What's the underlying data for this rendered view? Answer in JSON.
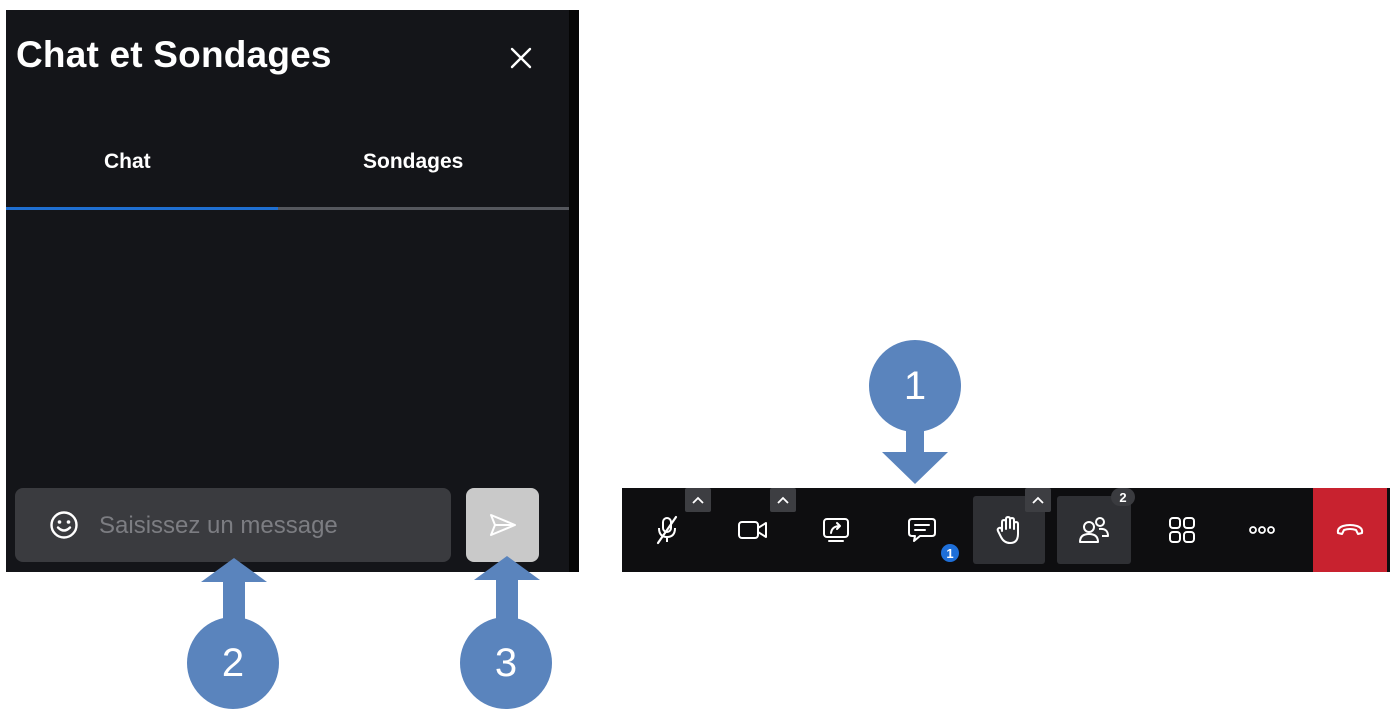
{
  "chat_panel": {
    "title": "Chat et Sondages",
    "close_icon": "close-icon",
    "tabs": [
      {
        "label": "Chat",
        "active": true
      },
      {
        "label": "Sondages",
        "active": false
      }
    ],
    "input": {
      "placeholder": "Saisissez un message",
      "value": "",
      "emoji_icon": "emoji-icon"
    },
    "send_icon": "send-icon"
  },
  "toolbar": {
    "items": [
      {
        "name": "microphone-muted",
        "icon": "mic-off-icon",
        "has_menu": true
      },
      {
        "name": "camera",
        "icon": "video-camera-icon",
        "has_menu": true
      },
      {
        "name": "share-screen",
        "icon": "screen-share-icon"
      },
      {
        "name": "chat",
        "icon": "chat-bubble-icon",
        "badge": "1"
      },
      {
        "name": "raise-hand",
        "icon": "hand-icon",
        "has_menu": true
      },
      {
        "name": "participants",
        "icon": "participants-icon",
        "badge": "2"
      },
      {
        "name": "view",
        "icon": "grid-icon"
      },
      {
        "name": "more",
        "icon": "more-dots-icon"
      },
      {
        "name": "end-call",
        "icon": "phone-hangup-icon"
      }
    ],
    "colors": {
      "background": "#0e0e10",
      "end_call": "#c8222f",
      "badge": "#1e6fd9"
    }
  },
  "annotations": [
    {
      "label": "1",
      "target": "chat"
    },
    {
      "label": "2",
      "target": "message-input"
    },
    {
      "label": "3",
      "target": "send-button"
    }
  ],
  "colors": {
    "panel_bg": "#141519",
    "tab_active": "#1f6fd1",
    "marker": "#5a84bd"
  }
}
